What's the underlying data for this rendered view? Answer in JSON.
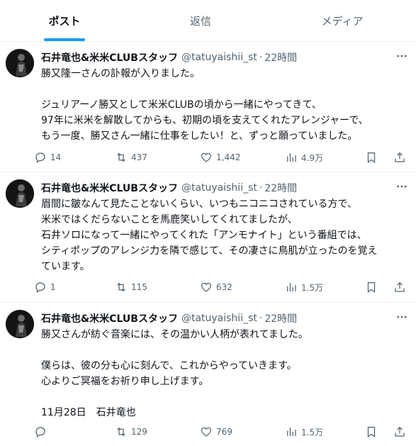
{
  "tabs": [
    {
      "label": "ポスト",
      "active": true
    },
    {
      "label": "返信",
      "active": false
    },
    {
      "label": "メディア",
      "active": false
    }
  ],
  "tweets": [
    {
      "name": "石井竜也&米米CLUBスタッフ",
      "handle": "@tatuyaishii_st",
      "separator": "·",
      "time": "22時間",
      "lines": [
        "勝又隆一さんの訃報が入りました。",
        "",
        "ジュリアーノ勝又として米米CLUBの頃から一緒にやってきて、",
        "97年に米米を解散してからも、初期の頃を支えてくれたアレンジャーで、",
        "もう一度、勝又さん一緒に仕事をしたい！と、ずっと願っていました。"
      ],
      "replies": "14",
      "reposts": "437",
      "likes": "1,442",
      "views": "4.9万"
    },
    {
      "name": "石井竜也&米米CLUBスタッフ",
      "handle": "@tatuyaishii_st",
      "separator": "·",
      "time": "22時間",
      "lines": [
        "眉間に皺なんて見たことないくらい、いつもニコニコされている方で、",
        "米米ではくだらないことを馬鹿笑いしてくれてましたが、",
        "石井ソロになって一緒にやってくれた「アンモナイト」という番組では、",
        "シティポップのアレンジ力を隣で感じて、その凄さに鳥肌が立ったのを覚え",
        "ています。"
      ],
      "replies": "1",
      "reposts": "115",
      "likes": "632",
      "views": "1.5万"
    },
    {
      "name": "石井竜也&米米CLUBスタッフ",
      "handle": "@tatuyaishii_st",
      "separator": "·",
      "time": "22時間",
      "lines": [
        "勝又さんが紡ぐ音楽には、その温かい人柄が表れてました。",
        "",
        "僕らは、彼の分も心に刻んで、これからやっていきます。",
        "心よりご冥福をお祈り申し上げます。",
        "",
        "11月28日　石井竜也"
      ],
      "replies": "",
      "reposts": "129",
      "likes": "769",
      "views": "1.5万"
    }
  ],
  "colors": {
    "accent": "#1d9bf0",
    "text": "#0f1419",
    "muted": "#536471",
    "divider": "#eff3f4"
  },
  "icons": [
    "reply-icon",
    "repost-icon",
    "like-icon",
    "views-icon",
    "bookmark-icon",
    "share-icon",
    "more-icon"
  ]
}
